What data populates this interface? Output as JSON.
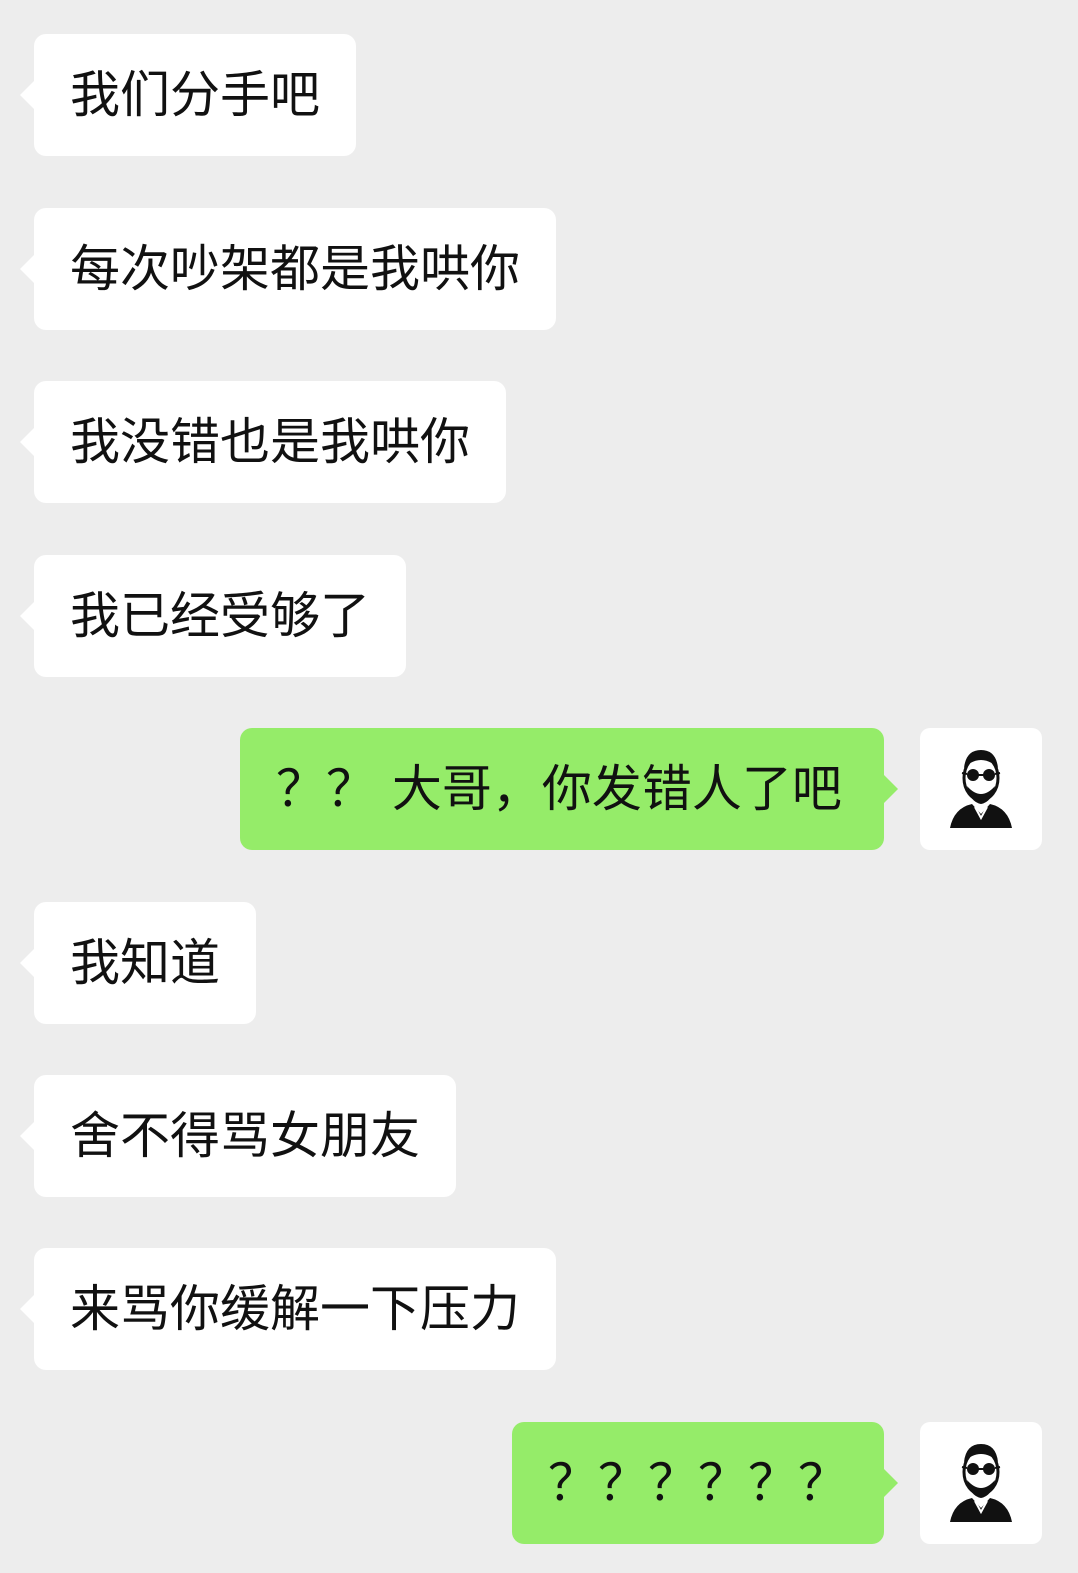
{
  "colors": {
    "background": "#ededed",
    "incoming_bubble": "#ffffff",
    "outgoing_bubble": "#95ec69",
    "text": "#111111"
  },
  "messages": [
    {
      "side": "incoming",
      "text": "我们分手吧"
    },
    {
      "side": "incoming",
      "text": "每次吵架都是我哄你"
    },
    {
      "side": "incoming",
      "text": "我没错也是我哄你"
    },
    {
      "side": "incoming",
      "text": "我已经受够了"
    },
    {
      "side": "outgoing",
      "text": "？？ 大哥，你发错人了吧",
      "avatar": "man-with-sunglasses-icon"
    },
    {
      "side": "incoming",
      "text": "我知道"
    },
    {
      "side": "incoming",
      "text": "舍不得骂女朋友"
    },
    {
      "side": "incoming",
      "text": "来骂你缓解一下压力"
    },
    {
      "side": "outgoing",
      "text": "？？？？？？",
      "avatar": "man-with-sunglasses-icon"
    }
  ]
}
